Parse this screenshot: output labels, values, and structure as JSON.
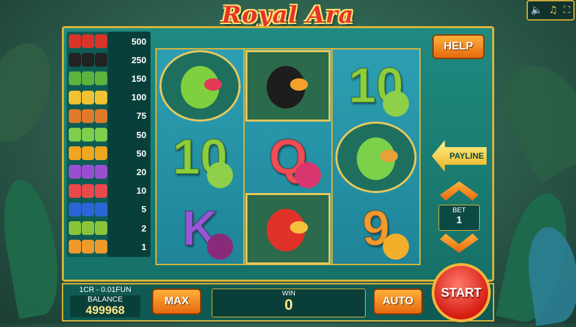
{
  "game": {
    "title": "Royal Ara"
  },
  "controls": {
    "sound_icon": "speaker-icon",
    "music_icon": "music-note-icon",
    "fullscreen_icon": "fullscreen-icon"
  },
  "paytable": [
    {
      "symbol": "scarlet-macaw",
      "payout": "500",
      "color": "#d8342a"
    },
    {
      "symbol": "toucan",
      "payout": "250",
      "color": "#222222"
    },
    {
      "symbol": "chameleon",
      "payout": "150",
      "color": "#5db43c"
    },
    {
      "symbol": "duck",
      "payout": "100",
      "color": "#f1c232"
    },
    {
      "symbol": "parrot",
      "payout": "75",
      "color": "#e07a2a"
    },
    {
      "symbol": "lovebird",
      "payout": "50",
      "color": "#7fcf4d"
    },
    {
      "symbol": "A",
      "payout": "50",
      "color": "#f0a61e"
    },
    {
      "symbol": "K",
      "payout": "20",
      "color": "#9a4fd1"
    },
    {
      "symbol": "Q",
      "payout": "10",
      "color": "#e8494b"
    },
    {
      "symbol": "J",
      "payout": "5",
      "color": "#2a66d8"
    },
    {
      "symbol": "10",
      "payout": "2",
      "color": "#8ac43a"
    },
    {
      "symbol": "9",
      "payout": "1",
      "color": "#f19a2c"
    }
  ],
  "reels": [
    [
      {
        "type": "pic",
        "name": "green-parrot"
      },
      {
        "type": "num",
        "text": "10",
        "color": "#8ccf3c"
      },
      {
        "type": "num",
        "text": "K",
        "color": "#9857d6"
      }
    ],
    [
      {
        "type": "pic",
        "name": "toucan"
      },
      {
        "type": "num",
        "text": "Q",
        "color": "#ef4d55"
      },
      {
        "type": "pic",
        "name": "scarlet-macaw"
      }
    ],
    [
      {
        "type": "num",
        "text": "10",
        "color": "#8ccf3c"
      },
      {
        "type": "pic",
        "name": "chameleon"
      },
      {
        "type": "num",
        "text": "9",
        "color": "#f39a2d"
      }
    ]
  ],
  "buttons": {
    "help": "HELP",
    "payline": "PAYLINE",
    "max": "MAX",
    "auto": "AUTO",
    "start": "START"
  },
  "bet": {
    "label": "BET",
    "value": "1"
  },
  "balance": {
    "rate": "1CR - 0.01FUN",
    "label": "BALANCE",
    "value": "499968"
  },
  "win": {
    "label": "WIN",
    "value": "0"
  }
}
